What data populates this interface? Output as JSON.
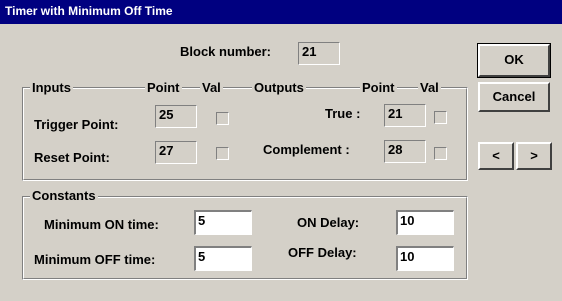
{
  "window": {
    "title": "Timer with Minimum Off Time"
  },
  "block": {
    "label": "Block number:",
    "value": "21"
  },
  "inputs": {
    "group_label": "Inputs",
    "point_header": "Point",
    "val_header": "Val",
    "trigger_label": "Trigger Point:",
    "trigger_point": "25",
    "reset_label": "Reset Point:",
    "reset_point": "27"
  },
  "outputs": {
    "group_label": "Outputs",
    "point_header": "Point",
    "val_header": "Val",
    "true_label": "True :",
    "true_point": "21",
    "complement_label": "Complement :",
    "complement_point": "28"
  },
  "constants": {
    "group_label": "Constants",
    "min_on_label": "Minimum ON time:",
    "min_on_value": "5",
    "min_off_label": "Minimum OFF time:",
    "min_off_value": "5",
    "on_delay_label": "ON Delay:",
    "on_delay_value": "10",
    "off_delay_label": "OFF Delay:",
    "off_delay_value": "10"
  },
  "buttons": {
    "ok": "OK",
    "cancel": "Cancel",
    "prev": "<",
    "next": ">"
  }
}
